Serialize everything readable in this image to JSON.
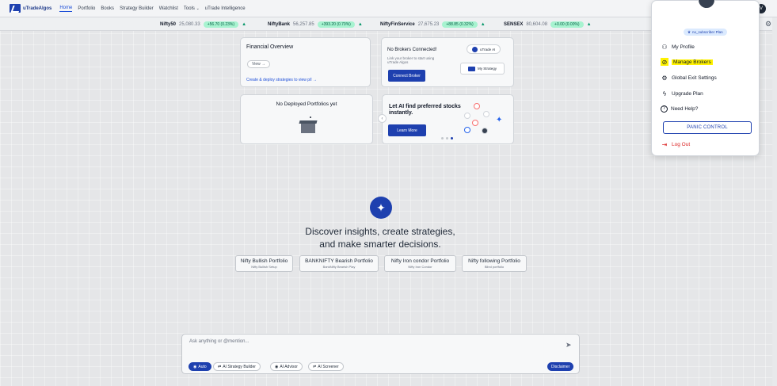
{
  "nav": {
    "logo_text": "uTradeAlgos",
    "items": [
      {
        "label": "Home",
        "active": true
      },
      {
        "label": "Portfolio",
        "active": false
      },
      {
        "label": "Books",
        "active": false
      },
      {
        "label": "Strategy Builder",
        "active": false
      },
      {
        "label": "Watchlist",
        "active": false
      },
      {
        "label": "Tools",
        "active": false
      },
      {
        "label": "uTrade Intelligence",
        "active": false
      }
    ],
    "tools_chevron": "⌄",
    "user_initial": "V"
  },
  "ticker": [
    {
      "name": "Nifty50",
      "value": "25,080.33",
      "change": "+56.70 (0.23%)",
      "arrow": "▲"
    },
    {
      "name": "NiftyBank",
      "value": "56,257.85",
      "change": "+393.20 (0.70%)",
      "arrow": "▲"
    },
    {
      "name": "NiftyFinService",
      "value": "27,675.23",
      "change": "+88.85 (0.32%)",
      "arrow": "▲"
    },
    {
      "name": "SENSEX",
      "value": "80,604.08",
      "change": "+0.00 (0.00%)",
      "arrow": "▲"
    }
  ],
  "cards": {
    "financial": {
      "title": "Financial Overview",
      "view": "View →",
      "link": "Create & deploy strategies to view p/l →"
    },
    "brokers": {
      "title": "No Brokers Connected!",
      "sub": "Link your broker to start using uTrade Algos",
      "button": "Connect Broker",
      "ai_pill": "uTrade AI",
      "my_strategy": "My Strategy"
    },
    "deployed": {
      "title": "No Deployed Portfolios yet"
    },
    "ai": {
      "headline": "Let AI find preferred stocks instantly.",
      "button": "Learn More",
      "prev": "‹"
    }
  },
  "hero": {
    "icon": "✦",
    "line1": "Discover insights, create strategies,",
    "line2": "and make smarter decisions."
  },
  "suggestions": [
    {
      "title": "Nifty Bullish Portfolio",
      "sub": "Nifty Bullish Setup"
    },
    {
      "title": "BANKNIFTY Bearish Portfolio",
      "sub": "BankNifty Bearish Play"
    },
    {
      "title": "Nifty Iron condor Portfolio",
      "sub": "Nifty Iron Condor"
    },
    {
      "title": "Nifty following Portfolio",
      "sub": "Blind portfolio"
    }
  ],
  "chat": {
    "placeholder": "Ask anything or @mention...",
    "send_icon": "➤",
    "chips": [
      {
        "label": "Auto",
        "icon": "◉"
      },
      {
        "label": "AI Strategy Builder",
        "icon": "⇄"
      },
      {
        "label": "AI Advisor",
        "icon": "◉"
      },
      {
        "label": "AI Screener",
        "icon": "⇌"
      }
    ],
    "disclaimer": "Disclaimer"
  },
  "dropdown": {
    "plan": "no_subscriber Plan",
    "plan_icon": "♛",
    "items": [
      {
        "label": "My Profile",
        "icon": "person-icon",
        "glyph": "⚇"
      },
      {
        "label": "Manage Brokers",
        "icon": "link-icon",
        "glyph": "⊘"
      },
      {
        "label": "Global Exit Settings",
        "icon": "gear-icon",
        "glyph": "⚙"
      },
      {
        "label": "Upgrade Plan",
        "icon": "bolt-icon",
        "glyph": "ϟ"
      },
      {
        "label": "Need Help?",
        "icon": "help-icon",
        "glyph": "?"
      }
    ],
    "panic": "PANIC CONTROL",
    "logout": "Log Out",
    "logout_glyph": "⇥"
  },
  "colors": {
    "accent": "#1e40af",
    "highlight": "#fff200",
    "logout": "#dc2626",
    "up": "#059669"
  }
}
